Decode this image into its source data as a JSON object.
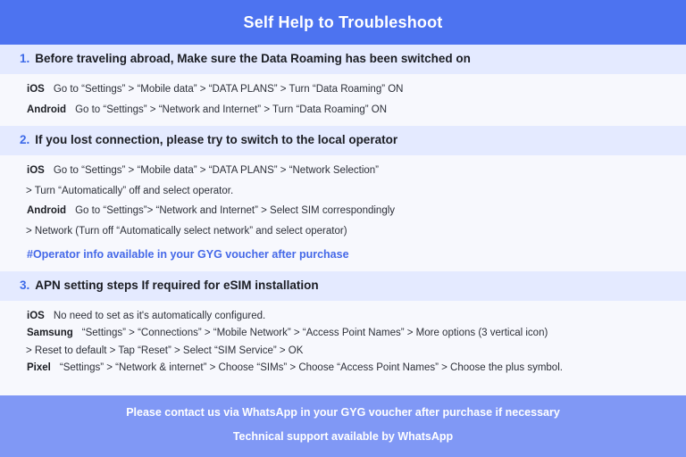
{
  "header": {
    "title": "Self Help to Troubleshoot",
    "background_color": "#4d73f0",
    "text_color": "#ffffff"
  },
  "theme": {
    "page_background": "#f7f8fd",
    "section_band_background": "#e4eaff",
    "accent_blue": "#3d6ae8",
    "note_blue": "#4468e8",
    "footer_background": "#8098f5",
    "body_text": "#2c2f38"
  },
  "sections": [
    {
      "number": "1.",
      "title": "Before traveling abroad, Make sure the Data Roaming has been switched on",
      "rows": [
        {
          "type": "device",
          "label": "iOS",
          "text": "Go to “Settings” > “Mobile data” > “DATA PLANS” > Turn “Data Roaming” ON"
        },
        {
          "type": "device",
          "label": "Android",
          "text": "Go to “Settings” > “Network and Internet” > Turn “Data Roaming” ON"
        }
      ]
    },
    {
      "number": "2.",
      "title": "If you lost connection, please try to switch to the local operator",
      "rows": [
        {
          "type": "device",
          "label": "iOS",
          "text": "Go to “Settings” > “Mobile data” > “DATA PLANS” > “Network Selection”"
        },
        {
          "type": "continuation",
          "text": "> Turn “Automatically” off and select operator."
        },
        {
          "type": "device",
          "label": "Android",
          "text": "Go to “Settings”>  “Network and Internet” > Select SIM correspondingly"
        },
        {
          "type": "continuation",
          "text": "> Network (Turn off “Automatically select network” and select operator)"
        },
        {
          "type": "note",
          "text": "#Operator info available in your GYG voucher after purchase"
        }
      ]
    },
    {
      "number": "3.",
      "title": "APN setting steps If required for eSIM installation",
      "rows": [
        {
          "type": "device",
          "label": "iOS",
          "text": "No need to set as it's automatically configured."
        },
        {
          "type": "device",
          "label": "Samsung",
          "text": "“Settings” > “Connections” > “Mobile Network” > “Access Point Names” > More options (3 vertical icon)"
        },
        {
          "type": "continuation",
          "text": "> Reset to default > Tap “Reset” > Select “SIM Service” > OK"
        },
        {
          "type": "device",
          "label": "Pixel",
          "text": "“Settings” > “Network & internet” > Choose “SIMs” > Choose “Access Point Names” > Choose the plus symbol."
        }
      ]
    }
  ],
  "footer": {
    "line1": "Please contact us via WhatsApp  in your GYG voucher after purchase if necessary",
    "line2": "Technical support available by WhatsApp"
  }
}
